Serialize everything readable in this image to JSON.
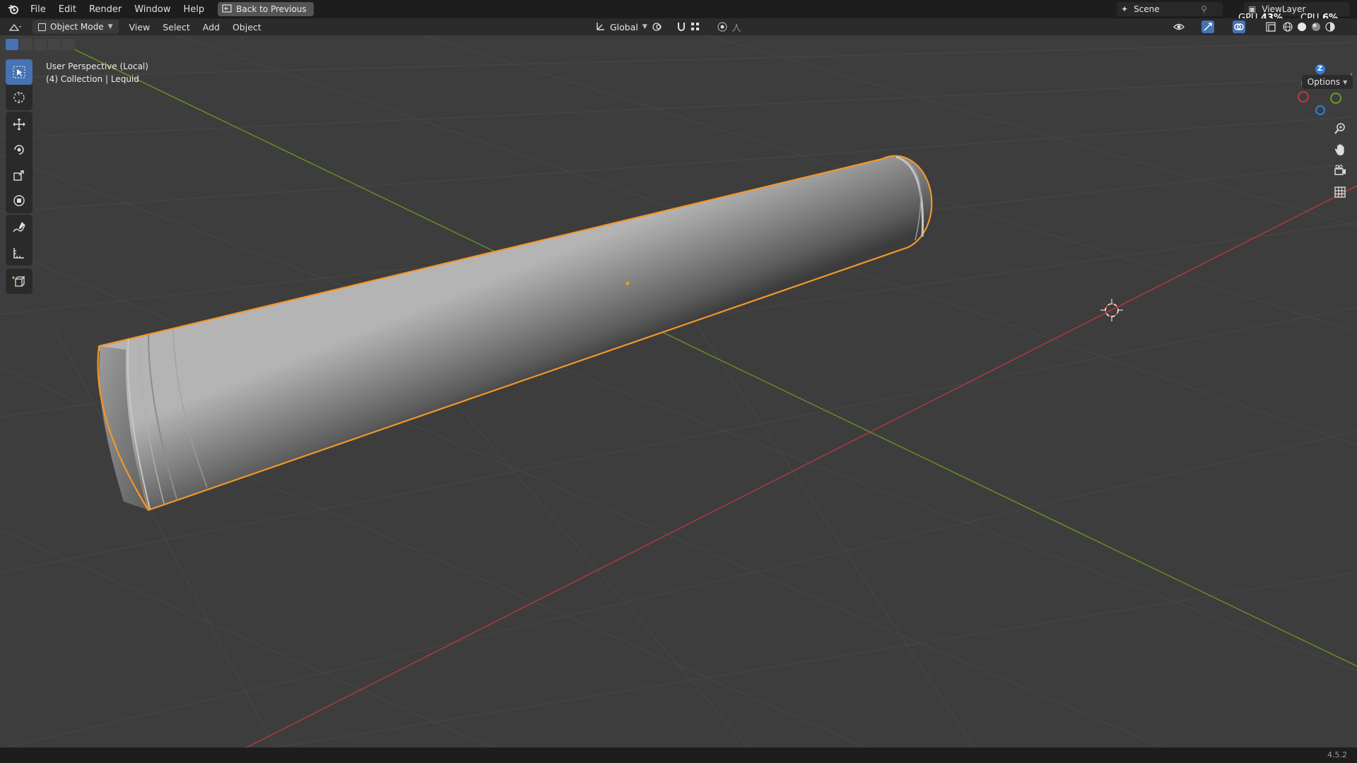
{
  "menu": {
    "items": [
      "File",
      "Edit",
      "Render",
      "Window",
      "Help"
    ],
    "back_button": "Back to Previous"
  },
  "scene": {
    "name": "Scene"
  },
  "view_layer": {
    "name": "ViewLayer"
  },
  "stats": {
    "gpu_label": "GPU",
    "gpu_value": "43%",
    "cpu_label": "CPU",
    "cpu_value": "6%"
  },
  "header": {
    "mode": "Object Mode",
    "menus": [
      "View",
      "Select",
      "Add",
      "Object"
    ],
    "orientation": "Global"
  },
  "viewport": {
    "perspective": "User Perspective (Local)",
    "collection": "(4) Collection | Lequid",
    "options": "Options"
  },
  "gizmo": {
    "x": "X",
    "y": "Y",
    "z": "Z"
  },
  "status": {
    "version": "4.5.2"
  },
  "colors": {
    "accent": "#4772b3",
    "selection_outline": "#f4962a",
    "x_axis": "#c1383e",
    "y_axis": "#6a9a21",
    "z_axis": "#2f7fd8"
  },
  "icons": [
    "blender-logo-icon",
    "back-icon",
    "editor-type-icon",
    "select-box-icon",
    "cursor-icon",
    "move-icon",
    "rotate-icon",
    "scale-icon",
    "transform-icon",
    "annotate-icon",
    "measure-icon",
    "add-cube-icon",
    "zoom-icon",
    "hand-icon",
    "camera-icon",
    "grid-icon"
  ]
}
